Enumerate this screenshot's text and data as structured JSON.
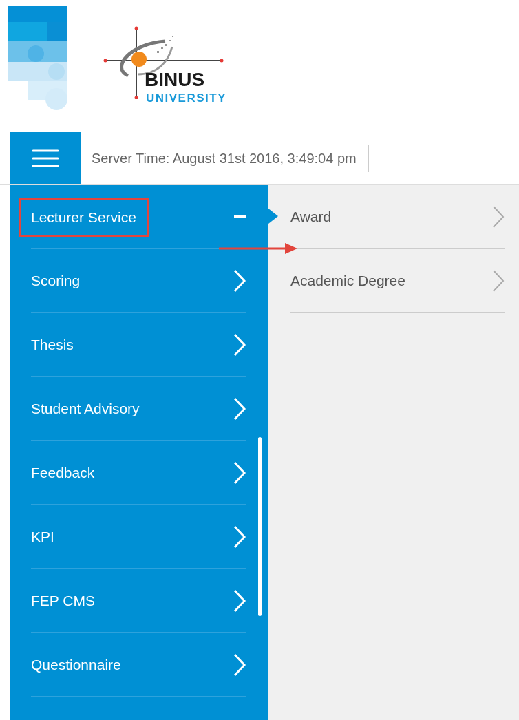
{
  "logo": {
    "name": "BINUS",
    "subtitle": "UNIVERSITY"
  },
  "header": {
    "server_time": "Server Time: August 31st 2016, 3:49:04 pm"
  },
  "sidebar": {
    "items": [
      {
        "label": "Lecturer Service",
        "expanded": true,
        "highlighted": true
      },
      {
        "label": "Scoring",
        "expanded": false,
        "highlighted": false
      },
      {
        "label": "Thesis",
        "expanded": false,
        "highlighted": false
      },
      {
        "label": "Student Advisory",
        "expanded": false,
        "highlighted": false
      },
      {
        "label": "Feedback",
        "expanded": false,
        "highlighted": false
      },
      {
        "label": "KPI",
        "expanded": false,
        "highlighted": false
      },
      {
        "label": "FEP CMS",
        "expanded": false,
        "highlighted": false
      },
      {
        "label": "Questionnaire",
        "expanded": false,
        "highlighted": false
      }
    ]
  },
  "submenu": {
    "items": [
      {
        "label": "Award",
        "selected": true
      },
      {
        "label": "Academic Degree",
        "selected": false
      }
    ]
  }
}
